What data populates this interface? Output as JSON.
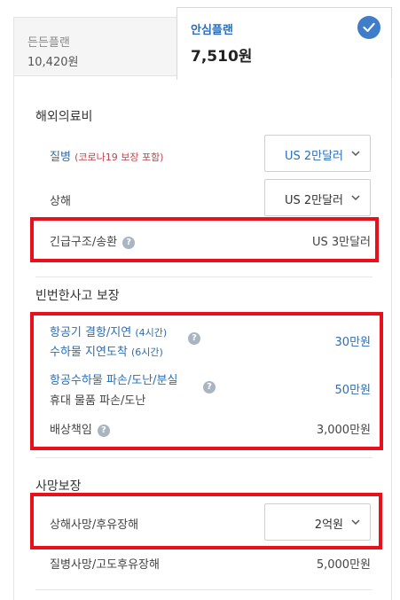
{
  "tabs": [
    {
      "name": "든든플랜",
      "price": "10,420원"
    },
    {
      "name": "안심플랜",
      "price": "7,510원"
    }
  ],
  "sections": {
    "medical": {
      "title": "해외의료비",
      "disease_label": "질병",
      "disease_note": "(코로나19 보장 포함)",
      "disease_value": "US 2만달러",
      "injury_label": "상해",
      "injury_value": "US 2만달러",
      "rescue_label": "긴급구조/송환",
      "rescue_value": "US 3만달러"
    },
    "frequent": {
      "title": "빈번한사고 보장",
      "flight_label": "항공기 결항/지연",
      "flight_note": "(4시간)",
      "baggage_delay_label": "수하물 지연도착",
      "baggage_delay_note": "(6시간)",
      "delay_value": "30만원",
      "baggage_damage_label": "항공수하물 파손/도난/분실",
      "goods_label": "휴대 물품 파손/도난",
      "damage_value": "50만원",
      "liability_label": "배상책임",
      "liability_value": "3,000만원"
    },
    "death": {
      "title": "사망보장",
      "accident_label": "상해사망/후유장해",
      "accident_value": "2억원",
      "illness_label": "질병사망/고도후유장해",
      "illness_value": "5,000만원"
    }
  },
  "help_glyph": "?",
  "icons": {
    "check": "check-icon",
    "chevron": "chevron-down-icon",
    "help": "help-icon"
  },
  "colors": {
    "accent": "#2a6eb5",
    "highlight": "#e8111b",
    "note": "#c2424a"
  }
}
